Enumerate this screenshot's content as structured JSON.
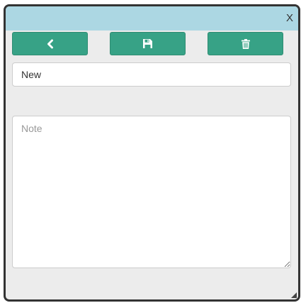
{
  "dialog": {
    "close_label": "X"
  },
  "toolbar": {
    "back_icon": "chevron-left-icon",
    "save_icon": "floppy-disk-icon",
    "delete_icon": "trash-icon",
    "button_color": "#37a286"
  },
  "form": {
    "title_value": "New",
    "note_value": "",
    "note_placeholder": "Note"
  },
  "colors": {
    "titlebar": "#acd7e3",
    "dialog_background": "#ececec",
    "border": "#333333"
  }
}
